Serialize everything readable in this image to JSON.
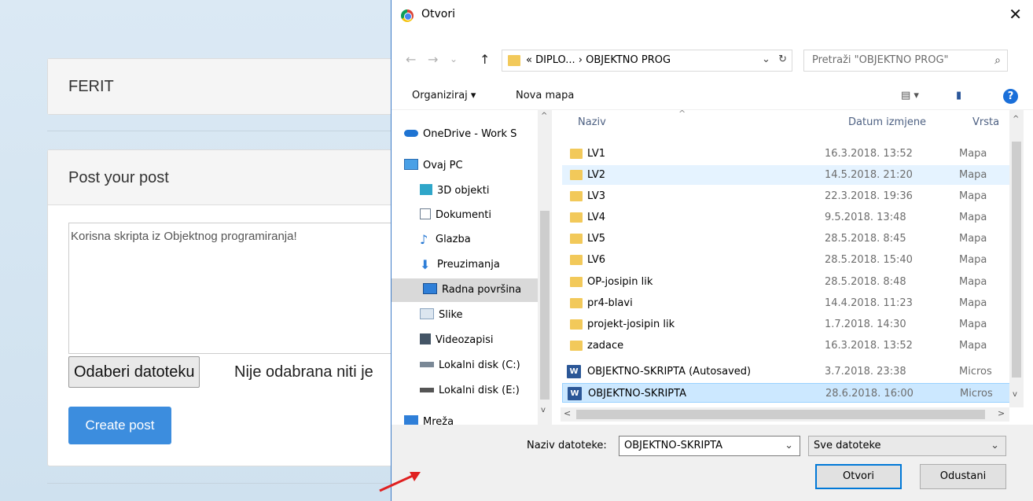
{
  "web": {
    "brand": "FERIT",
    "card_title": "Post your post",
    "textarea_value": "Korisna skripta iz Objektnog programiranja!",
    "file_button": "Odaberi datoteku",
    "file_status": "Nije odabrana niti je",
    "create_button": "Create post",
    "create_button_color": "#3c8dde"
  },
  "dialog": {
    "title": "Otvori",
    "close": "✕",
    "nav": {
      "back": "←",
      "forward": "→",
      "recent": "⌄",
      "up": "↑"
    },
    "address": {
      "path": "« DIPLO...  ›  OBJEKTNO PROG",
      "dropdown": "⌄",
      "refresh": "↻"
    },
    "search_placeholder": "Pretraži \"OBJEKTNO PROG\"",
    "toolbar": {
      "organize": "Organiziraj ▾",
      "new_folder": "Nova mapa",
      "view_menu": "▤ ▾",
      "preview_pane": "▮",
      "help": "?"
    },
    "nav_pane": [
      {
        "label": "OneDrive - Work S",
        "icon": "onedrive-icon",
        "color": "#1e73d2"
      },
      {
        "label": "Ovaj PC",
        "icon": "computer-icon",
        "color": "#4aa0e6"
      },
      {
        "label": "3D objekti",
        "icon": "3d-objects-icon",
        "color": "#2fa6c9"
      },
      {
        "label": "Dokumenti",
        "icon": "documents-icon",
        "color": "#6b7c8f"
      },
      {
        "label": "Glazba",
        "icon": "music-icon",
        "color": "#1e73d2"
      },
      {
        "label": "Preuzimanja",
        "icon": "downloads-icon",
        "color": "#2f7fd8"
      },
      {
        "label": "Radna površina",
        "icon": "desktop-icon",
        "color": "#2f7fd8"
      },
      {
        "label": "Slike",
        "icon": "pictures-icon",
        "color": "#8aa4bf"
      },
      {
        "label": "Videozapisi",
        "icon": "videos-icon",
        "color": "#445566"
      },
      {
        "label": "Lokalni disk (C:)",
        "icon": "drive-c-icon",
        "color": "#7a8896"
      },
      {
        "label": "Lokalni disk (E:)",
        "icon": "drive-e-icon",
        "color": "#555555"
      },
      {
        "label": "Mreža",
        "icon": "network-icon",
        "color": "#2f7fd8"
      }
    ],
    "columns": {
      "name": "Naziv",
      "date": "Datum izmjene",
      "type": "Vrsta"
    },
    "files": [
      {
        "name": "LV1",
        "date": "16.3.2018. 13:52",
        "type": "Mapa",
        "kind": "folder"
      },
      {
        "name": "LV2",
        "date": "14.5.2018. 21:20",
        "type": "Mapa",
        "kind": "folder"
      },
      {
        "name": "LV3",
        "date": "22.3.2018. 19:36",
        "type": "Mapa",
        "kind": "folder"
      },
      {
        "name": "LV4",
        "date": "9.5.2018. 13:48",
        "type": "Mapa",
        "kind": "folder"
      },
      {
        "name": "LV5",
        "date": "28.5.2018. 8:45",
        "type": "Mapa",
        "kind": "folder"
      },
      {
        "name": "LV6",
        "date": "28.5.2018. 15:40",
        "type": "Mapa",
        "kind": "folder"
      },
      {
        "name": "OP-josipin lik",
        "date": "28.5.2018. 8:48",
        "type": "Mapa",
        "kind": "folder"
      },
      {
        "name": "pr4-blavi",
        "date": "14.4.2018. 11:23",
        "type": "Mapa",
        "kind": "folder"
      },
      {
        "name": "projekt-josipin lik",
        "date": "1.7.2018. 14:30",
        "type": "Mapa",
        "kind": "folder"
      },
      {
        "name": "zadace",
        "date": "16.3.2018. 13:52",
        "type": "Mapa",
        "kind": "folder"
      },
      {
        "name": "OBJEKTNO-SKRIPTA (Autosaved)",
        "date": "3.7.2018. 23:38",
        "type": "Micros",
        "kind": "word"
      },
      {
        "name": "OBJEKTNO-SKRIPTA",
        "date": "28.6.2018. 16:00",
        "type": "Micros",
        "kind": "word"
      }
    ],
    "filename_label": "Naziv datoteke:",
    "filename_value": "OBJEKTNO-SKRIPTA",
    "filetype_value": "Sve datoteke",
    "open_button": "Otvori",
    "cancel_button": "Odustani",
    "accent_color": "#0078d7"
  }
}
